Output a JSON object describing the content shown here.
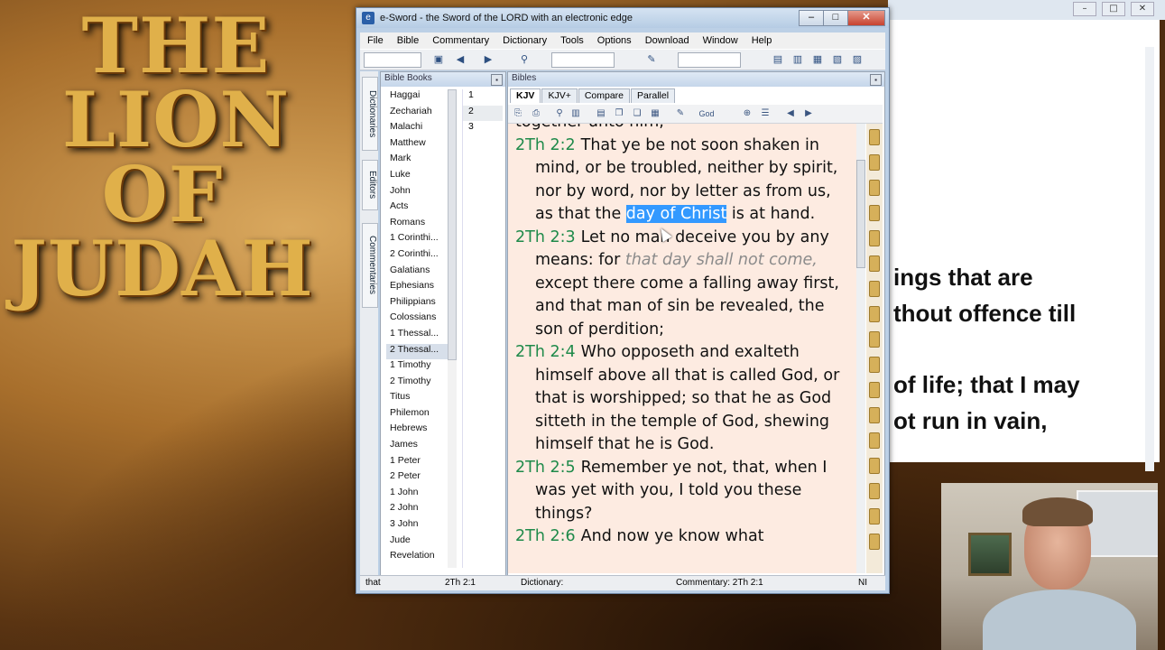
{
  "background_art": {
    "line1": "THE",
    "line2": "LION",
    "line3": "OF JUDAH"
  },
  "window": {
    "title": "e-Sword - the Sword of the LORD with an electronic edge",
    "controls": {
      "minimize": "–",
      "maximize": "□",
      "close": "✕"
    }
  },
  "menu": [
    "File",
    "Bible",
    "Commentary",
    "Dictionary",
    "Tools",
    "Options",
    "Download",
    "Window",
    "Help"
  ],
  "side_tabs": [
    "Dictionaries",
    "Editors",
    "Commentaries"
  ],
  "books_pane": {
    "header": "Bible Books",
    "books": [
      "Haggai",
      "Zechariah",
      "Malachi",
      "Matthew",
      "Mark",
      "Luke",
      "John",
      "Acts",
      "Romans",
      "1 Corinthi...",
      "2 Corinthi...",
      "Galatians",
      "Ephesians",
      "Philippians",
      "Colossians",
      "1 Thessal...",
      "2 Thessal...",
      "1 Timothy",
      "2 Timothy",
      "Titus",
      "Philemon",
      "Hebrews",
      "James",
      "1 Peter",
      "2 Peter",
      "1 John",
      "2 John",
      "3 John",
      "Jude",
      "Revelation"
    ],
    "selected_book": "2 Thessal...",
    "chapters": [
      "1",
      "2",
      "3"
    ],
    "selected_chapter": "2"
  },
  "bible_pane": {
    "header": "Bibles",
    "tabs": [
      "KJV",
      "KJV+",
      "Compare",
      "Parallel"
    ],
    "active_tab": "KJV",
    "toolbar_dropdown": "God",
    "top_fragment": "together unto him,",
    "verses": [
      {
        "ref": "2Th 2:2",
        "before": "That ye be not soon shaken in mind, or be troubled, neither by spirit, nor by word, nor by letter as from us, as that the ",
        "highlight": "day of Christ",
        "after": " is at hand."
      },
      {
        "ref": "2Th 2:3",
        "before": "Let no man deceive you by any means: for ",
        "italic": "that day shall not come,",
        "after": " except there come a falling away first, and that man of sin be revealed, the son of perdition;"
      },
      {
        "ref": "2Th 2:4",
        "text": "Who opposeth and exalteth himself above all that is called God, or that is worshipped; so that he as God sitteth in the temple of God, shewing himself that he is God."
      },
      {
        "ref": "2Th 2:5",
        "text": "Remember ye not, that, when I was yet with you, I told you these things?"
      },
      {
        "ref": "2Th 2:6",
        "text": "And now ye know what"
      }
    ]
  },
  "status": {
    "search": "that",
    "verse": "2Th 2:1",
    "dictionary": "Dictionary:",
    "commentary": "Commentary: 2Th 2:1",
    "mode": "NI"
  },
  "document_behind": {
    "lines": [
      "ings that are",
      "thout offence till",
      "of life; that I may",
      "ot run in vain,"
    ]
  },
  "colors": {
    "verse_ref": "#1f8a4a",
    "highlight": "#3399ff",
    "text_bg": "#fdebe1"
  }
}
